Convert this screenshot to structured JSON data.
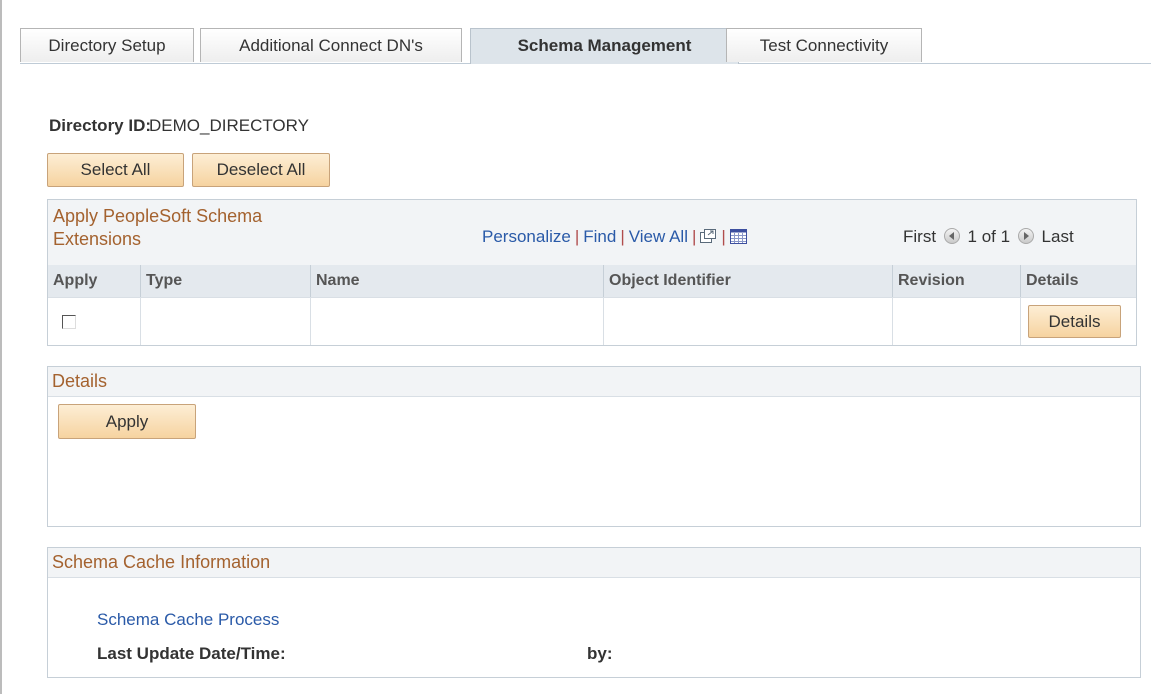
{
  "tabs": [
    {
      "label": "Directory Setup",
      "active": false
    },
    {
      "label": "Additional Connect DN's",
      "active": false
    },
    {
      "label": "Schema Management",
      "active": true
    },
    {
      "label": "Test Connectivity",
      "active": false
    }
  ],
  "directory": {
    "label": "Directory ID:",
    "value": "DEMO_DIRECTORY"
  },
  "buttons": {
    "select_all": "Select All",
    "deselect_all": "Deselect All",
    "details": "Details",
    "apply": "Apply"
  },
  "grid": {
    "title": "Apply PeopleSoft Schema Extensions",
    "nav": {
      "personalize": "Personalize",
      "find": "Find",
      "view_all": "View All",
      "sep": "|"
    },
    "pager": {
      "first": "First",
      "range": "1 of 1",
      "last": "Last"
    },
    "columns": [
      "Apply",
      "Type",
      "Name",
      "Object Identifier",
      "Revision",
      "Details"
    ],
    "row": {
      "apply_checked": false,
      "type": "",
      "name": "",
      "object_identifier": "",
      "revision": ""
    }
  },
  "details_section": {
    "title": "Details"
  },
  "cache_section": {
    "title": "Schema Cache Information",
    "process_link": "Schema Cache Process",
    "last_update_label": "Last Update Date/Time:",
    "by_label": "by:"
  },
  "colors": {
    "accent_text": "#a4622f",
    "link": "#2a5aa8",
    "button": "#f6d3a0"
  },
  "icons": [
    "zoom-icon",
    "grid-download-icon",
    "previous-row-icon",
    "next-row-icon"
  ]
}
